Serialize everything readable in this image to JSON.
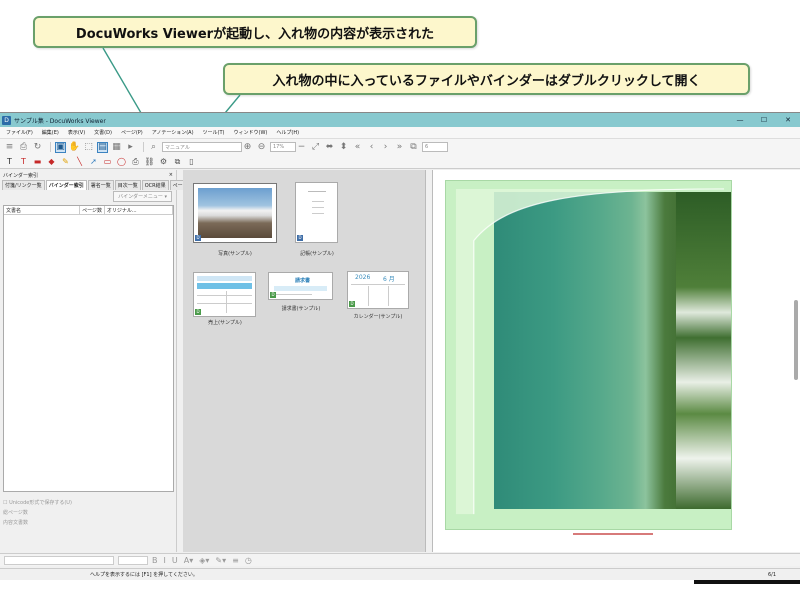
{
  "callouts": {
    "top": "DocuWorks Viewerが起動し、入れ物の内容が表示された",
    "middle": "入れ物の中に入っているファイルやバインダーはダブルクリックして開く"
  },
  "window": {
    "title": "サンプル集 - DocuWorks Viewer",
    "minimize": "—",
    "maximize": "☐",
    "close": "✕"
  },
  "menu": [
    "ファイル(F)",
    "編集(E)",
    "表示(V)",
    "文書(D)",
    "ページ(P)",
    "アノテーション(A)",
    "ツール(T)",
    "ウィンドウ(W)",
    "ヘルプ(H)"
  ],
  "toolbar": {
    "view_mode": "マニュアル",
    "zoom": "17%",
    "page_number": "6"
  },
  "left_panel": {
    "title": "バインダー索引",
    "tabs": [
      "付箋/リンク一覧",
      "バインダー索引",
      "署名一覧",
      "目次一覧",
      "OCR結果",
      "ページ属性"
    ],
    "binder_menu": "バインダーメニュー",
    "columns": [
      "文書名",
      "ページ数",
      "オリジナル..."
    ],
    "unicode_option": "Unicode形式で保存する(U)",
    "page_count_label": "総ページ数",
    "content_label": "内容文書数"
  },
  "thumbnails": [
    {
      "label": "写真(サンプル)"
    },
    {
      "label": "記帳(サンプル)"
    },
    {
      "label": "売上(サンプル)"
    },
    {
      "label": "請求書(サンプル)"
    },
    {
      "label": "カレンダー(サンプル)"
    }
  ],
  "thumb_text": {
    "calendar_year": "2026",
    "calendar_month": "6 月",
    "invoice_title": "請求書"
  },
  "status": {
    "help_text": "ヘルプを表示するには [F1] を押してください。",
    "page_indicator": "6/1"
  }
}
